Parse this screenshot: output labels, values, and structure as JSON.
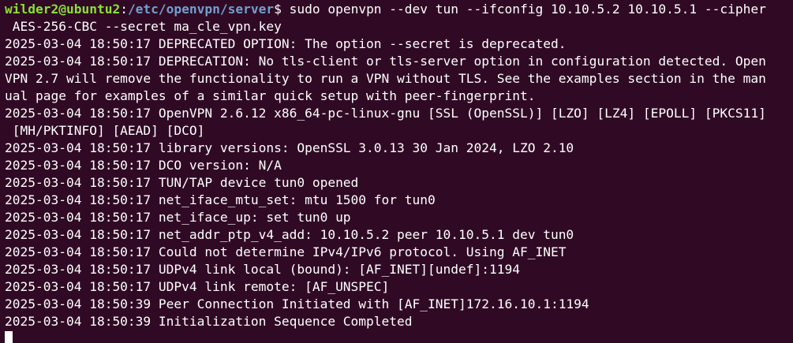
{
  "prompt": {
    "user_host": "wilder2@ubuntu2",
    "separator": ":",
    "path": "/etc/openvpn/server",
    "symbol": "$ ",
    "command_line1": "sudo openvpn --dev tun --ifconfig 10.10.5.2 10.10.5.1 --cipher",
    "command_line2": " AES-256-CBC --secret ma_cle_vpn.key"
  },
  "output_lines": [
    "2025-03-04 18:50:17 DEPRECATED OPTION: The option --secret is deprecated.",
    "2025-03-04 18:50:17 DEPRECATION: No tls-client or tls-server option in configuration detected. Open",
    "VPN 2.7 will remove the functionality to run a VPN without TLS. See the examples section in the man",
    "ual page for examples of a similar quick setup with peer-fingerprint.",
    "2025-03-04 18:50:17 OpenVPN 2.6.12 x86_64-pc-linux-gnu [SSL (OpenSSL)] [LZO] [LZ4] [EPOLL] [PKCS11]",
    " [MH/PKTINFO] [AEAD] [DCO]",
    "2025-03-04 18:50:17 library versions: OpenSSL 3.0.13 30 Jan 2024, LZO 2.10",
    "2025-03-04 18:50:17 DCO version: N/A",
    "2025-03-04 18:50:17 TUN/TAP device tun0 opened",
    "2025-03-04 18:50:17 net_iface_mtu_set: mtu 1500 for tun0",
    "2025-03-04 18:50:17 net_iface_up: set tun0 up",
    "2025-03-04 18:50:17 net_addr_ptp_v4_add: 10.10.5.2 peer 10.10.5.1 dev tun0",
    "2025-03-04 18:50:17 Could not determine IPv4/IPv6 protocol. Using AF_INET",
    "2025-03-04 18:50:17 UDPv4 link local (bound): [AF_INET][undef]:1194",
    "2025-03-04 18:50:17 UDPv4 link remote: [AF_UNSPEC]",
    "2025-03-04 18:50:39 Peer Connection Initiated with [AF_INET]172.16.10.1:1194",
    "2025-03-04 18:50:39 Initialization Sequence Completed"
  ],
  "colors": {
    "background": "#300a24",
    "text": "#ffffff",
    "user_host": "#8ae234",
    "path": "#729fcf"
  }
}
